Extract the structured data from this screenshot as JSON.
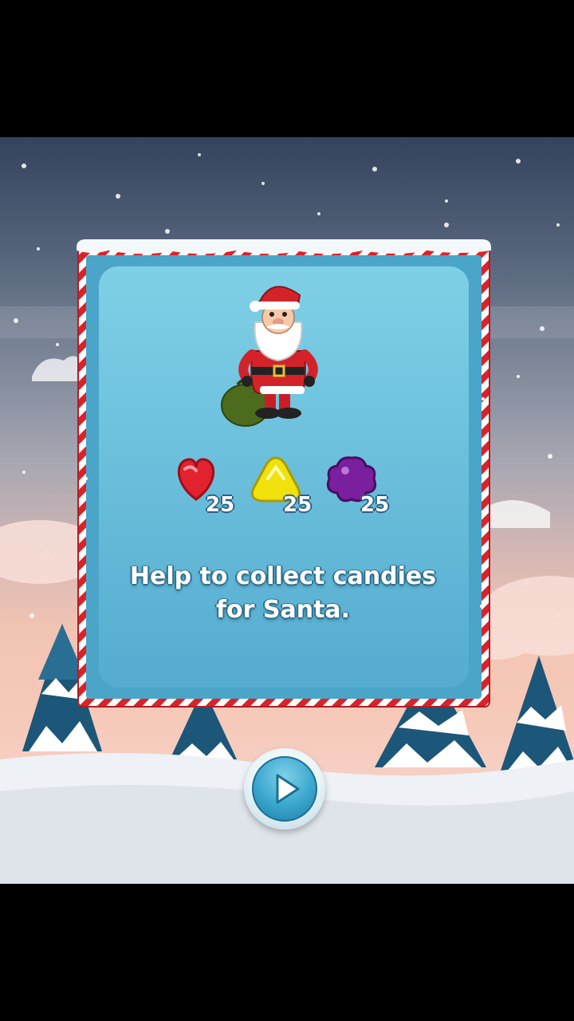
{
  "intro": {
    "message_line1": "Help to collect candies",
    "message_line2": "for Santa."
  },
  "goals": [
    {
      "candy": "red-heart-candy",
      "color": "#e3222f",
      "count": "25"
    },
    {
      "candy": "yellow-triangle-candy",
      "color": "#f1e10c",
      "count": "25"
    },
    {
      "candy": "purple-flower-candy",
      "color": "#7a1f9e",
      "count": "25"
    }
  ],
  "controls": {
    "play_icon": "play-icon"
  },
  "colors": {
    "panel_bg": "#63b9d3",
    "frame_red": "#d8232a",
    "button_blue": "#3aa6cd"
  }
}
